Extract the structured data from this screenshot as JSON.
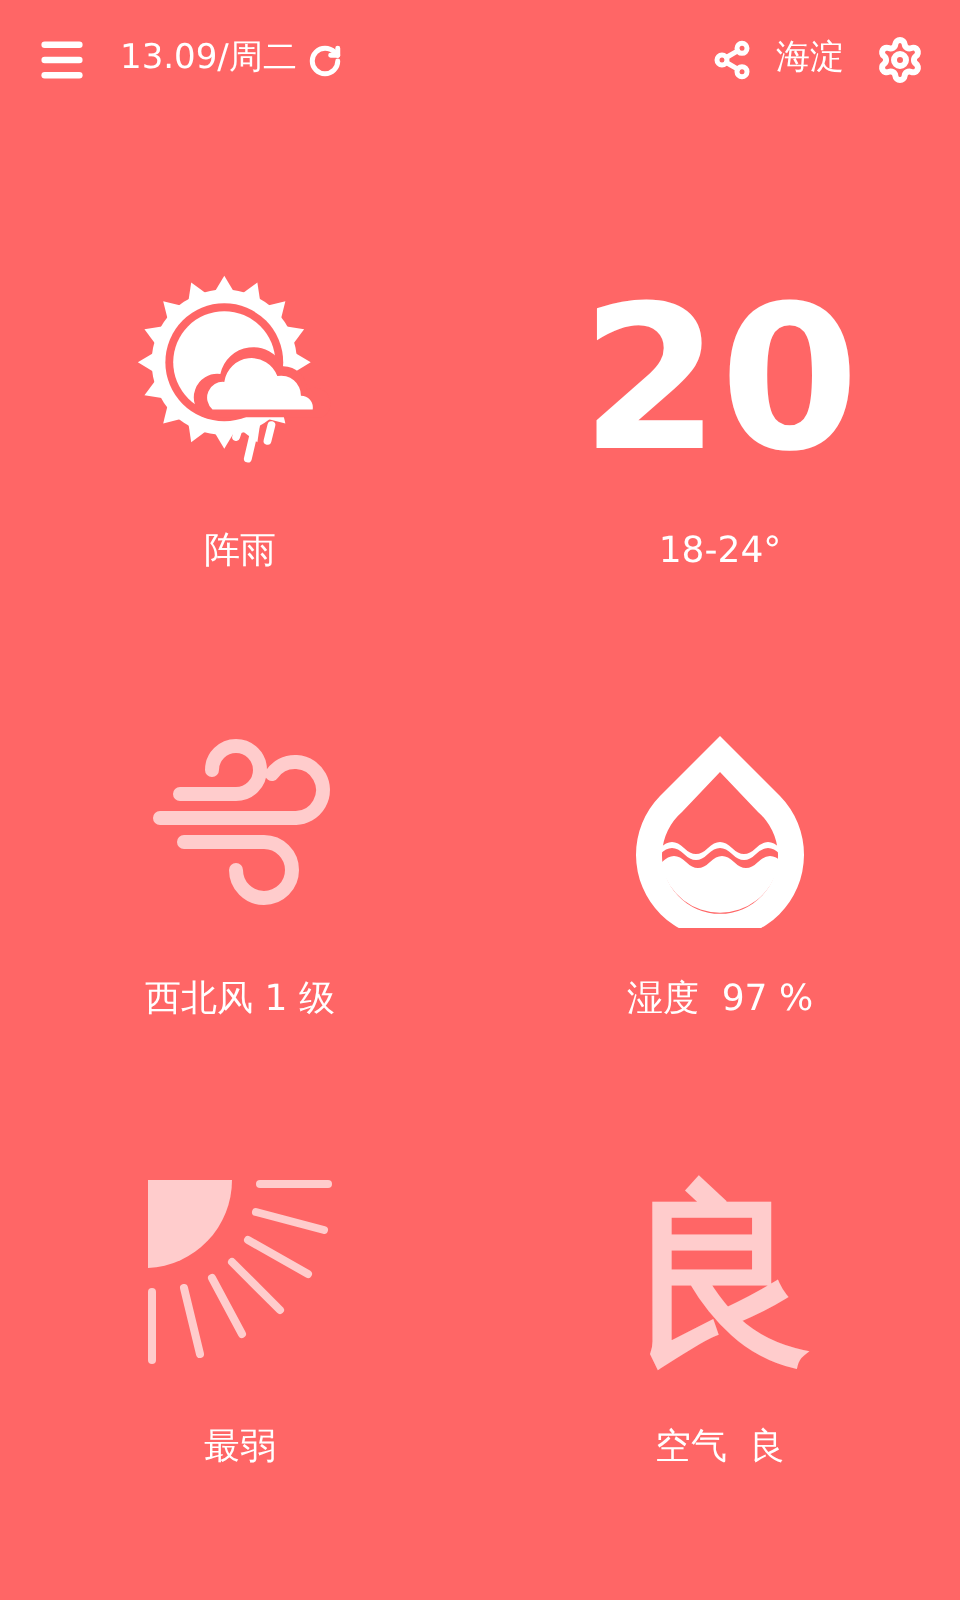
{
  "header": {
    "date": "13.09/周二",
    "location": "海淀"
  },
  "rows": [
    {
      "figures": [
        {
          "kind": "condition"
        },
        {
          "kind": "temperature",
          "value": "20"
        }
      ],
      "labels": [
        "阵雨",
        "18-24°"
      ]
    },
    {
      "figures": [
        {
          "kind": "wind"
        },
        {
          "kind": "humidity"
        }
      ],
      "labels": [
        "西北风 1 级",
        "湿度  97 %"
      ]
    },
    {
      "figures": [
        {
          "kind": "uv"
        },
        {
          "kind": "air",
          "glyph": "良"
        }
      ],
      "labels": [
        "最弱",
        "空气  良"
      ]
    }
  ]
}
